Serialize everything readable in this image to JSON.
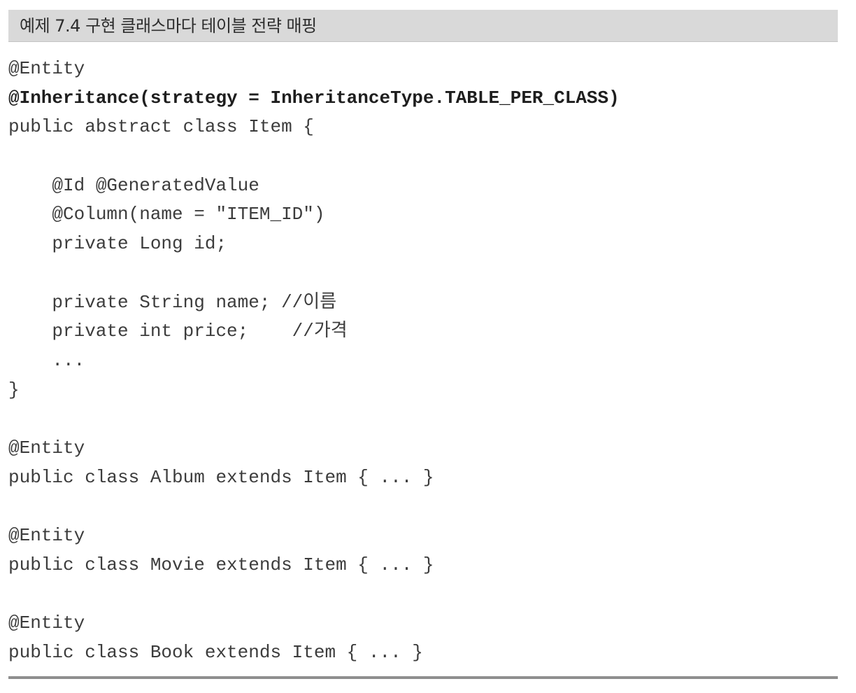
{
  "caption": {
    "title": "예제 7.4 구현 클래스마다 테이블 전략 매핑"
  },
  "code": {
    "lines": [
      "@Entity",
      "@Inheritance(strategy = InheritanceType.TABLE_PER_CLASS)",
      "public abstract class Item {",
      "",
      "    @Id @GeneratedValue",
      "    @Column(name = \"ITEM_ID\")",
      "    private Long id;",
      "",
      "    private String name; //이름",
      "    private int price;    //가격",
      "    ...",
      "}",
      "",
      "@Entity",
      "public class Album extends Item { ... }",
      "",
      "@Entity",
      "public class Movie extends Item { ... }",
      "",
      "@Entity",
      "public class Book extends Item { ... }"
    ]
  }
}
